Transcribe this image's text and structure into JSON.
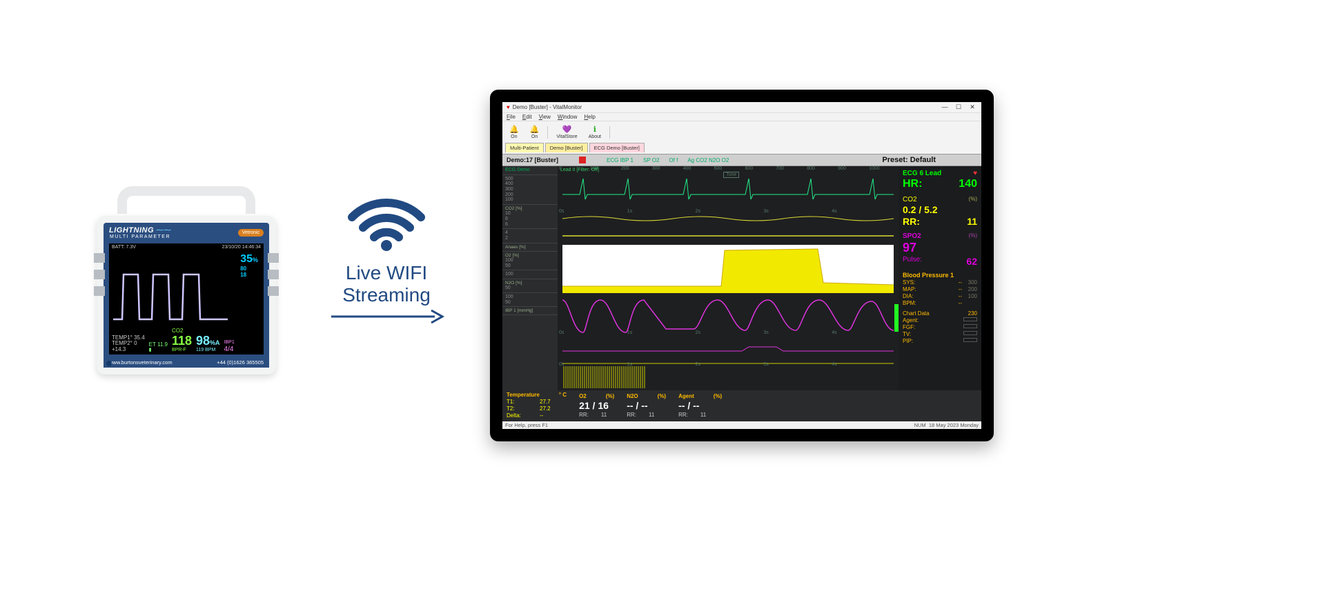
{
  "device": {
    "brand_line1": "LIGHTNING",
    "brand_line2": "MULTI PARAMETER",
    "brand_badge": "Vetronic",
    "screen_top_left": "BATT: 7.3V",
    "screen_top_right": "23/10/20 14:46:34",
    "screen_pct": "35",
    "screen_pct_unit": "%",
    "screen_sub1": "80",
    "screen_sub2": "18",
    "bottom_temp1": "TEMP1° 35.4",
    "bottom_temp2": "TEMP2° 0",
    "bottom_diff": "+14.3",
    "bottom_et": "ET 11.9",
    "bottom_co2": "CO2",
    "bottom_co2_val": "118",
    "bottom_co2_lbl": "BPR-F",
    "bottom_spo2_val": "98",
    "bottom_spo2_unit": "%A",
    "bottom_spo2_lbl": "119 BPM",
    "bottom_ibp": "IBP1",
    "bottom_ibp_val": "4/4",
    "footer_left": "www.burtonsveterinary.com",
    "footer_right": "+44 (0)1626 365505"
  },
  "wifi": {
    "line1": "Live WIFI",
    "line2": "Streaming"
  },
  "app": {
    "title": "Demo [Buster] - VitalMonitor",
    "menu": [
      "File",
      "Edit",
      "View",
      "Window",
      "Help"
    ],
    "toolbar": [
      {
        "icon": "🔔",
        "label": "On",
        "color": "#c00"
      },
      {
        "icon": "🔔",
        "label": "On",
        "color": "#29f"
      },
      {
        "icon": "💜",
        "label": "VitalStore",
        "color": "#96c"
      },
      {
        "icon": "ℹ",
        "label": "About",
        "color": "#2a2"
      }
    ],
    "tabs": [
      {
        "label": "Multi-Patient",
        "cls": ""
      },
      {
        "label": "Demo [Buster]",
        "cls": "active"
      },
      {
        "label": "ECG Demo [Buster]",
        "cls": "pink"
      }
    ]
  },
  "infobar": {
    "left": "Demo:17 [Buster]",
    "badges": [
      "ECG IBP 1",
      "SP O2",
      "Of f",
      "Ag CO2 N2O O2"
    ],
    "preset": "Preset: Default"
  },
  "ylabs": [
    {
      "t": "ECG Demo",
      "c": "#0a5"
    },
    {
      "t": "500\n400\n300\n200\n100",
      "c": "#888"
    },
    {
      "t": "10\n8\n6",
      "c": "#888",
      "extra": "CO2 [%]"
    },
    {
      "t": "4\n2",
      "c": "#888"
    },
    {
      "t": "",
      "extra": "Anaes [%]"
    },
    {
      "t": "100\n50",
      "c": "#888",
      "extra": "O2 [%]"
    },
    {
      "t": "100",
      "c": "#888"
    },
    {
      "t": "50",
      "c": "#888",
      "extra": "N2O [%]"
    },
    {
      "t": "100\n50",
      "c": "#888"
    },
    {
      "t": "",
      "extra": "IBP 1 [mmHg]"
    }
  ],
  "plots": {
    "lead_label": "Lead II [Filter: Off]",
    "time_badge": "Time",
    "xticks_sec": [
      "0s",
      "1s",
      "2s",
      "3s",
      "4s"
    ],
    "xticks_ms": [
      "0",
      "100",
      "200",
      "300",
      "400",
      "500",
      "600",
      "700",
      "800",
      "900",
      "1000"
    ]
  },
  "rpanel": {
    "ecg": "ECG 6 Lead",
    "hr_label": "HR:",
    "hr": "140",
    "co2_label": "CO2",
    "co2_unit": "(%)",
    "co2_vals": "0.2  /  5.2",
    "rr_label": "RR:",
    "rr": "11",
    "spo2_label": "SPO2",
    "spo2_unit": "(%)",
    "spo2": "97",
    "pulse_label": "Pulse:",
    "pulse": "62",
    "bp_title": "Blood Pressure 1",
    "bp_rows": [
      [
        "SYS:",
        "--"
      ],
      [
        "MAP:",
        "--"
      ],
      [
        "DIA:",
        "--"
      ],
      [
        "BPM:",
        "--"
      ]
    ],
    "bp_scale": [
      "300",
      "200",
      "100"
    ],
    "chart_data_label": "Chart Data",
    "chart_rows": [
      "Agent:",
      "FGF:",
      "TV:",
      "PIP:"
    ],
    "chart_num": "230"
  },
  "bstrip": {
    "groups": [
      {
        "hd": "Temperature",
        "unit": "° C",
        "rows": [
          [
            "T1:",
            "27.7"
          ],
          [
            "T2:",
            "27.2"
          ],
          [
            "Delta:",
            "--"
          ]
        ],
        "yl": true
      },
      {
        "hd": "O2",
        "unit": "(%)",
        "big": "21  /  16",
        "sub": [
          "RR:",
          "11"
        ]
      },
      {
        "hd": "N2O",
        "unit": "(%)",
        "big": "--   /  --",
        "sub": [
          "RR:",
          "11"
        ]
      },
      {
        "hd": "Agent",
        "unit": "(%)",
        "big": "--   /  --",
        "sub": [
          "RR:",
          "11"
        ]
      }
    ]
  },
  "status": {
    "left": "For Help, press F1",
    "right1": "18 May 2023",
    "right2": "Monday",
    "num": "NUM"
  }
}
